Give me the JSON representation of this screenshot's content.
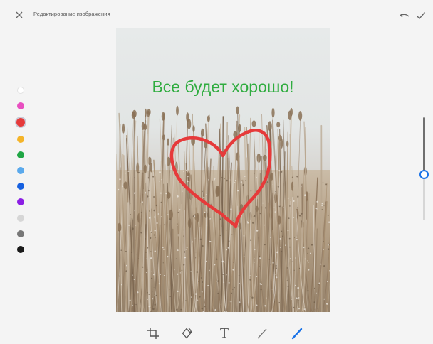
{
  "header": {
    "title": "Редактирование изображения",
    "close_icon": "close-icon",
    "undo_icon": "undo-icon",
    "apply_icon": "check-icon"
  },
  "palette": {
    "colors": [
      "#ffffff",
      "#e84fc0",
      "#e63a3a",
      "#f4b429",
      "#20a645",
      "#5aa9ec",
      "#1660e0",
      "#8b1ee4",
      "#d6d6d6",
      "#777777",
      "#1a1a1a"
    ],
    "selected_index": 2
  },
  "image": {
    "description_icon": "photo-frozen-reeds",
    "overlay_text": "Все будет хорошо!",
    "overlay_text_color": "#2fac3f",
    "drawing_color": "#e63a3a"
  },
  "brush_slider": {
    "level": 0.55,
    "accent_color": "#1a73e8"
  },
  "toolbar": {
    "tools": [
      {
        "name": "crop-tool",
        "icon": "crop-icon"
      },
      {
        "name": "rotate-tool",
        "icon": "rotate-icon"
      },
      {
        "name": "text-tool",
        "icon": "text-icon",
        "glyph": "T"
      },
      {
        "name": "line-tool",
        "icon": "line-icon"
      },
      {
        "name": "pen-tool",
        "icon": "pen-icon",
        "active": true
      }
    ]
  }
}
